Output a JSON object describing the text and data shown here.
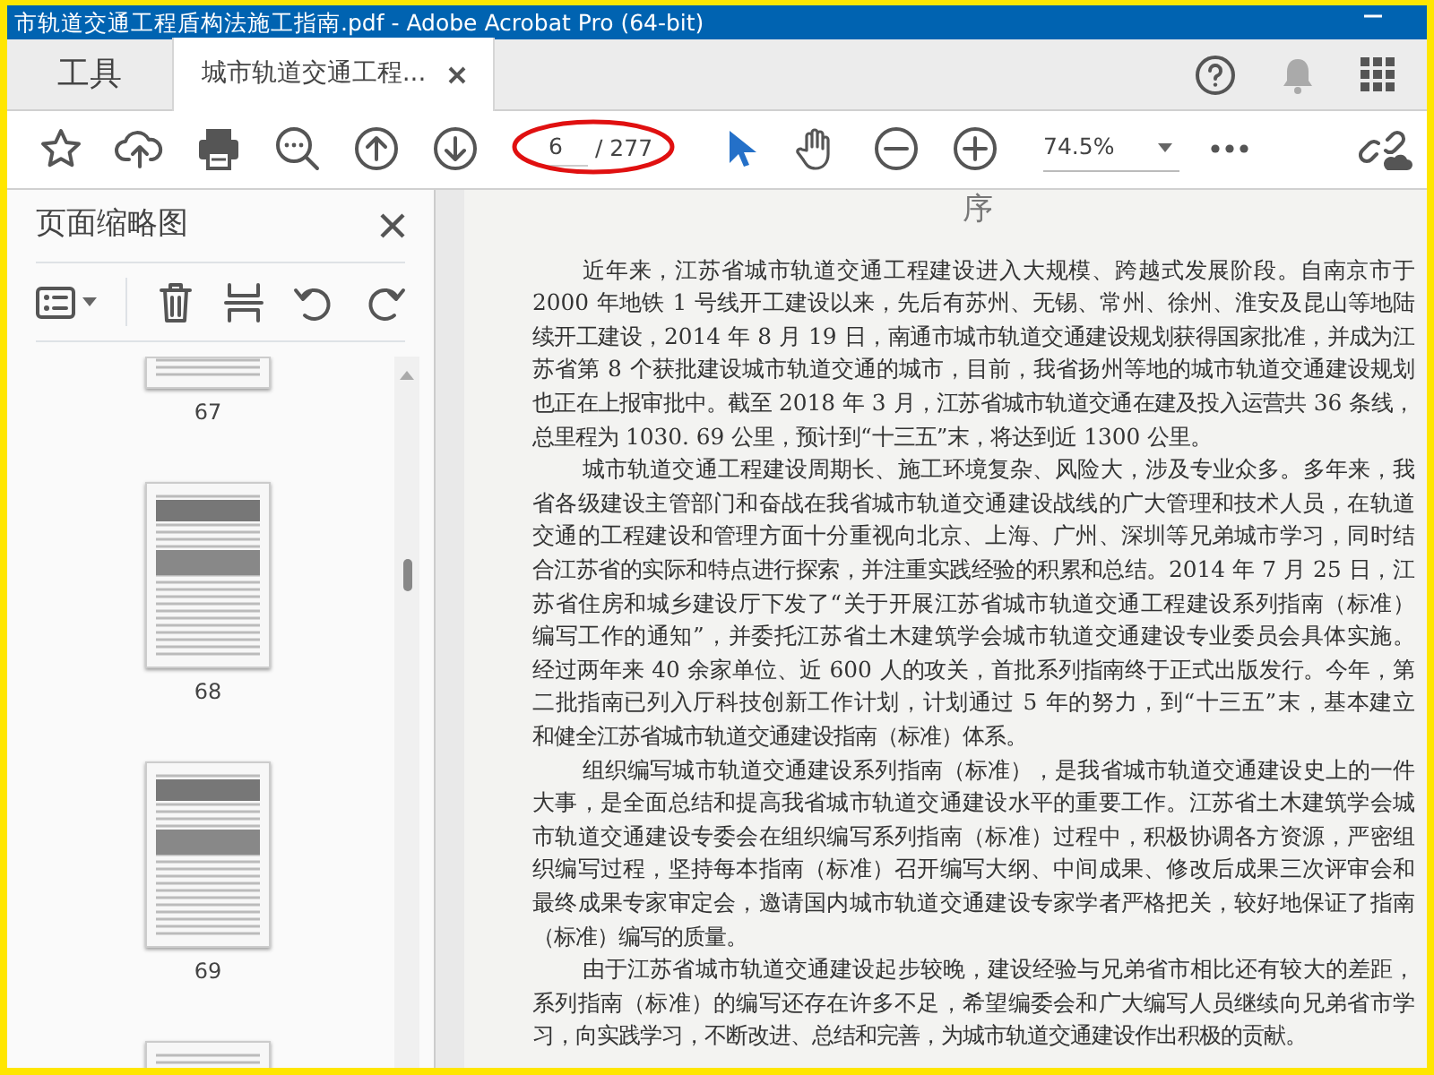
{
  "window": {
    "title": "市轨道交通工程盾构法施工指南.pdf - Adobe Acrobat Pro (64-bit)"
  },
  "tabs": [
    {
      "label": "工具",
      "kind": "home",
      "selected": false
    },
    {
      "label": "城市轨道交通工程...",
      "kind": "document",
      "selected": true
    }
  ],
  "toolbar": {
    "page_number": "6",
    "page_total": "/ 277",
    "zoom": "74.5%"
  },
  "thumbnails_panel": {
    "title": "页面缩略图",
    "pages": [
      {
        "kind": "text",
        "label": "67",
        "cut": true
      },
      {
        "kind": "figures",
        "label": "68"
      },
      {
        "kind": "figures",
        "label": "69"
      },
      {
        "kind": "text"
      }
    ]
  },
  "document": {
    "heading": "序",
    "paragraphs": [
      {
        "lines": [
          "近年来，江苏省城市轨道交通工程建设进入大规模、跨越式发展阶段。自南京市于",
          "2000 年地铁 1 号线开工建设以来，先后有苏州、无锡、常州、徐州、淮安及昆山等地陆",
          "续开工建设，2014 年 8 月 19 日，南通市城市轨道交通建设规划获得国家批准，并成为江",
          "苏省第 8 个获批建设城市轨道交通的城市，目前，我省扬州等地的城市轨道交通建设规划",
          "也正在上报审批中。截至 2018 年 3 月，江苏省城市轨道交通在建及投入运营共 36 条线，",
          "总里程为 1030. 69 公里，预计到“十三五”末，将达到近 1300 公里。"
        ]
      },
      {
        "lines": [
          "城市轨道交通工程建设周期长、施工环境复杂、风险大，涉及专业众多。多年来，我",
          "省各级建设主管部门和奋战在我省城市轨道交通建设战线的广大管理和技术人员，在轨道",
          "交通的工程建设和管理方面十分重视向北京、上海、广州、深圳等兄弟城市学习，同时结",
          "合江苏省的实际和特点进行探索，并注重实践经验的积累和总结。2014 年 7 月 25 日，江",
          "苏省住房和城乡建设厅下发了“关于开展江苏省城市轨道交通工程建设系列指南（标准）",
          "编写工作的通知”，并委托江苏省土木建筑学会城市轨道交通建设专业委员会具体实施。",
          "经过两年来 40 余家单位、近 600 人的攻关，首批系列指南终于正式出版发行。今年，第",
          "二批指南已列入厅科技创新工作计划，计划通过 5 年的努力，到“十三五”末，基本建立",
          "和健全江苏省城市轨道交通建设指南（标准）体系。"
        ]
      },
      {
        "lines": [
          "组织编写城市轨道交通建设系列指南（标准），是我省城市轨道交通建设史上的一件",
          "大事，是全面总结和提高我省城市轨道交通建设水平的重要工作。江苏省土木建筑学会城",
          "市轨道交通建设专委会在组织编写系列指南（标准）过程中，积极协调各方资源，严密组",
          "织编写过程，坚持每本指南（标准）召开编写大纲、中间成果、修改后成果三次评审会和",
          "最终成果专家审定会，邀请国内城市轨道交通建设专家学者严格把关，较好地保证了指南",
          "（标准）编写的质量。"
        ]
      },
      {
        "lines": [
          "由于江苏省城市轨道交通建设起步较晚，建设经验与兄弟省市相比还有较大的差距，",
          "系列指南（标准）的编写还存在许多不足，希望编委会和广大编写人员继续向兄弟省市学",
          "习，向实践学习，不断改进、总结和完善，为城市轨道交通建设作出积极的贡献。"
        ]
      }
    ]
  }
}
